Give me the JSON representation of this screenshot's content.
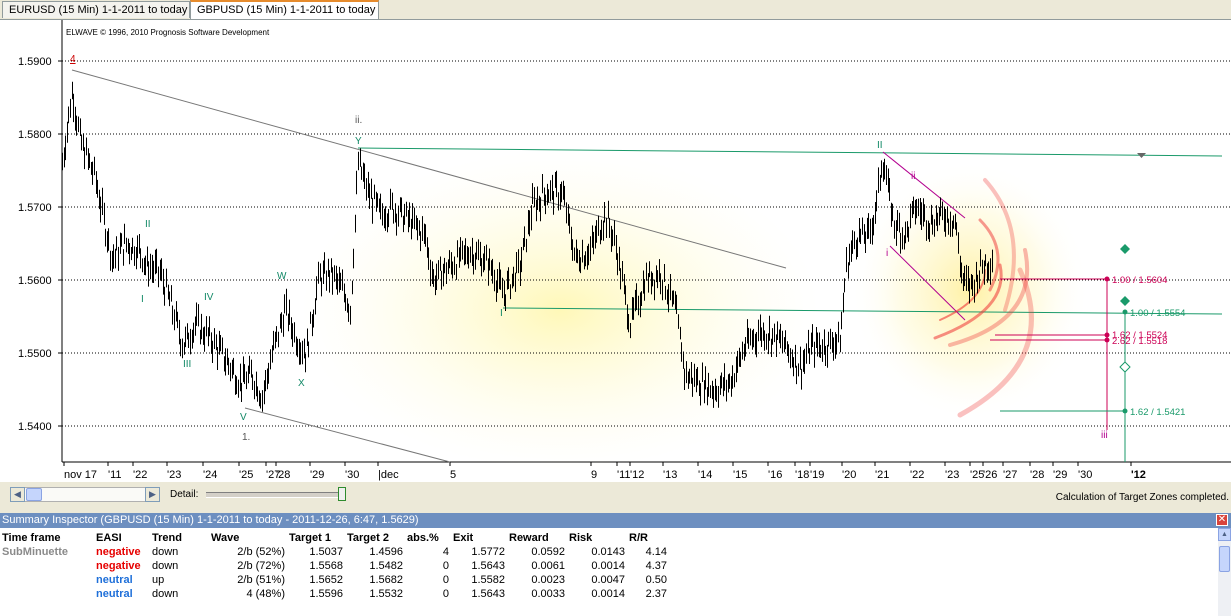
{
  "tabs": [
    {
      "label": "EURUSD (15 Min)  1-1-2011 to today",
      "active": false
    },
    {
      "label": "GBPUSD (15 Min)  1-1-2011 to today",
      "active": true
    }
  ],
  "chart": {
    "copyright": "ELWAVE © 1996, 2010 Prognosis Software Development",
    "y_ticks": [
      "1.5900",
      "1.5800",
      "1.5700",
      "1.5600",
      "1.5500",
      "1.5400"
    ],
    "x_ticks": [
      "nov 17",
      "'11",
      "'22",
      "'23",
      "'24",
      "'25",
      "'27",
      "'28",
      "'29",
      "'30",
      "|dec",
      "5",
      "9",
      "'11",
      "'12",
      "'13",
      "'14",
      "'15",
      "'16",
      "'18",
      "'19",
      "'20",
      "'21",
      "'22",
      "'23",
      "'25",
      "'26",
      "'27",
      "'28",
      "'29",
      "'30",
      "'12"
    ],
    "wave_labels": [
      {
        "text": "4",
        "color": "#cc0000"
      },
      {
        "text": "ii.",
        "color": "#555555"
      },
      {
        "text": "Y",
        "color": "#118866"
      },
      {
        "text": "II",
        "color": "#118866"
      },
      {
        "text": "I",
        "color": "#118866"
      },
      {
        "text": "IV",
        "color": "#118866"
      },
      {
        "text": "III",
        "color": "#118866"
      },
      {
        "text": "W",
        "color": "#118866"
      },
      {
        "text": "X",
        "color": "#118866"
      },
      {
        "text": "V",
        "color": "#118866"
      },
      {
        "text": "1.",
        "color": "#555555"
      },
      {
        "text": "I",
        "color": "#118866"
      },
      {
        "text": "II",
        "color": "#118866"
      },
      {
        "text": "ii",
        "color": "#b3008f"
      },
      {
        "text": "i",
        "color": "#b3008f"
      },
      {
        "text": "iii",
        "color": "#b3008f"
      }
    ],
    "targets": [
      {
        "text": "1.00 / 1.5604",
        "color": "#cc0055"
      },
      {
        "text": "1.00 / 1.5554",
        "color": "#1a9a6a"
      },
      {
        "text": "1.62 / 1.5524",
        "color": "#cc0055"
      },
      {
        "text": "2.62 / 1.5518",
        "color": "#cc0055"
      },
      {
        "text": "1.62 / 1.5421",
        "color": "#1a9a6a"
      }
    ]
  },
  "controls": {
    "detail_label": "Detail:",
    "status": "Calculation of Target Zones completed."
  },
  "summary": {
    "title": "Summary Inspector (GBPUSD (15 Min)  1-1-2011 to today - 2011-12-26, 6:47, 1.5629)",
    "columns": [
      "Time frame",
      "EASI",
      "Trend",
      "Wave",
      "Target 1",
      "Target 2",
      "abs.%",
      "Exit",
      "Reward",
      "Risk",
      "R/R"
    ],
    "rows": [
      {
        "timeframe": "SubMinuette",
        "easi": "negative",
        "easi_class": "neg",
        "trend": "down",
        "wave": "2/b (52%)",
        "t1": "1.5037",
        "t2": "1.4596",
        "abs": "4",
        "exit": "1.5772",
        "reward": "0.0592",
        "risk": "0.0143",
        "rr": "4.14"
      },
      {
        "timeframe": "",
        "easi": "negative",
        "easi_class": "neg",
        "trend": "down",
        "wave": "2/b (72%)",
        "t1": "1.5568",
        "t2": "1.5482",
        "abs": "0",
        "exit": "1.5643",
        "reward": "0.0061",
        "risk": "0.0014",
        "rr": "4.37"
      },
      {
        "timeframe": "",
        "easi": "neutral",
        "easi_class": "neu",
        "trend": "up",
        "wave": "2/b (51%)",
        "t1": "1.5652",
        "t2": "1.5682",
        "abs": "0",
        "exit": "1.5582",
        "reward": "0.0023",
        "risk": "0.0047",
        "rr": "0.50"
      },
      {
        "timeframe": "",
        "easi": "neutral",
        "easi_class": "neu",
        "trend": "down",
        "wave": "4 (48%)",
        "t1": "1.5596",
        "t2": "1.5532",
        "abs": "0",
        "exit": "1.5643",
        "reward": "0.0033",
        "risk": "0.0014",
        "rr": "2.37"
      }
    ]
  }
}
